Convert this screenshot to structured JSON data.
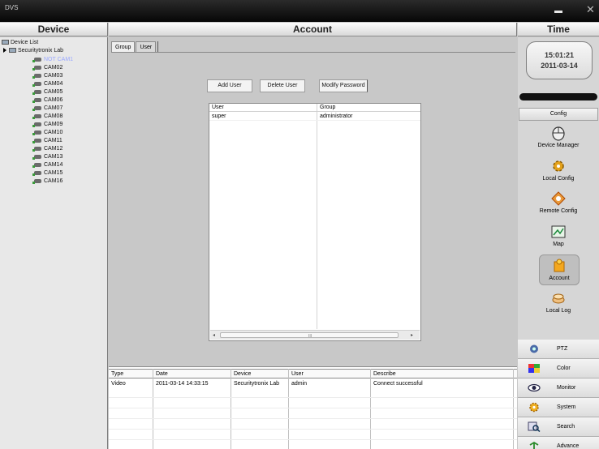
{
  "window": {
    "app_title": "DVS",
    "close_glyph": "✕"
  },
  "headers": {
    "device": "Device",
    "account": "Account",
    "time": "Time"
  },
  "device_tree": {
    "root": "Device List",
    "group": "Securitytronix Lab",
    "cameras": [
      "NOT CAM1",
      "CAM02",
      "CAM03",
      "CAM04",
      "CAM05",
      "CAM06",
      "CAM07",
      "CAM08",
      "CAM09",
      "CAM10",
      "CAM11",
      "CAM12",
      "CAM13",
      "CAM14",
      "CAM15",
      "CAM16"
    ]
  },
  "account": {
    "tabs": [
      "Group",
      "User"
    ],
    "buttons": {
      "add_user": "Add User",
      "delete_user": "Delete User",
      "modify_password": "Modify Password"
    },
    "user_table": {
      "columns": [
        "User",
        "Group"
      ],
      "rows": [
        {
          "user": "super",
          "group": "administrator"
        }
      ],
      "scroll_grip": "III"
    }
  },
  "log": {
    "columns": [
      "Type",
      "Date",
      "Device",
      "User",
      "Describe"
    ],
    "rows": [
      {
        "type": "Video",
        "date": "2011-03-14 14:33:15",
        "device": "Securitytronix Lab",
        "user": "admin",
        "describe": "Connect successful"
      }
    ]
  },
  "time_panel": {
    "time": "15:01:21",
    "date": "2011-03-14"
  },
  "config_menu": {
    "header": "Config",
    "items": [
      "Device Manager",
      "Local Config",
      "Remote Config",
      "Map",
      "Account",
      "Local Log"
    ]
  },
  "side_buttons": [
    "PTZ",
    "Color",
    "Monitor",
    "System",
    "Search",
    "Advance"
  ],
  "colors": {
    "title_bar": "#0a0a0a",
    "panel_bg": "#c8c8c8",
    "selected_cam": "#9aa8ff"
  }
}
